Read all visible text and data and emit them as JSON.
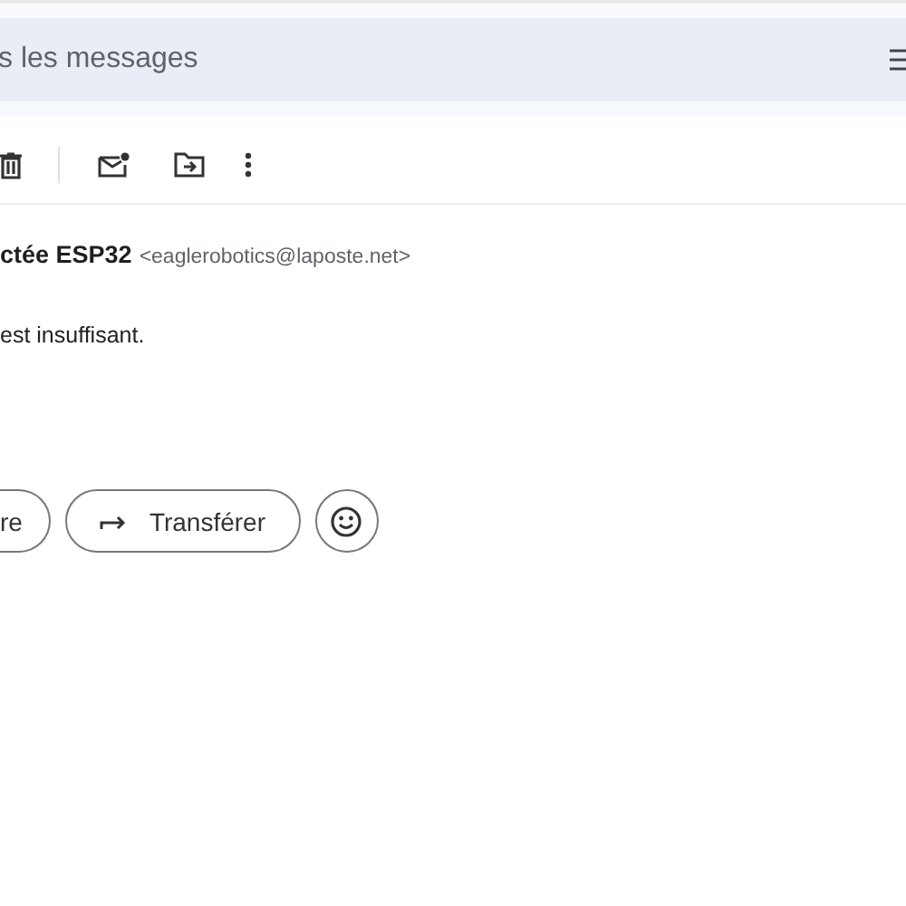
{
  "search": {
    "placeholder": "s les messages"
  },
  "sender": {
    "name": "ctée ESP32",
    "email": "<eaglerobotics@laposte.net>"
  },
  "body": "est insuffisant.",
  "actions": [
    {
      "kind": "reply",
      "label": "re"
    },
    {
      "kind": "forward",
      "label": "Transférer"
    },
    {
      "kind": "emoji"
    }
  ]
}
